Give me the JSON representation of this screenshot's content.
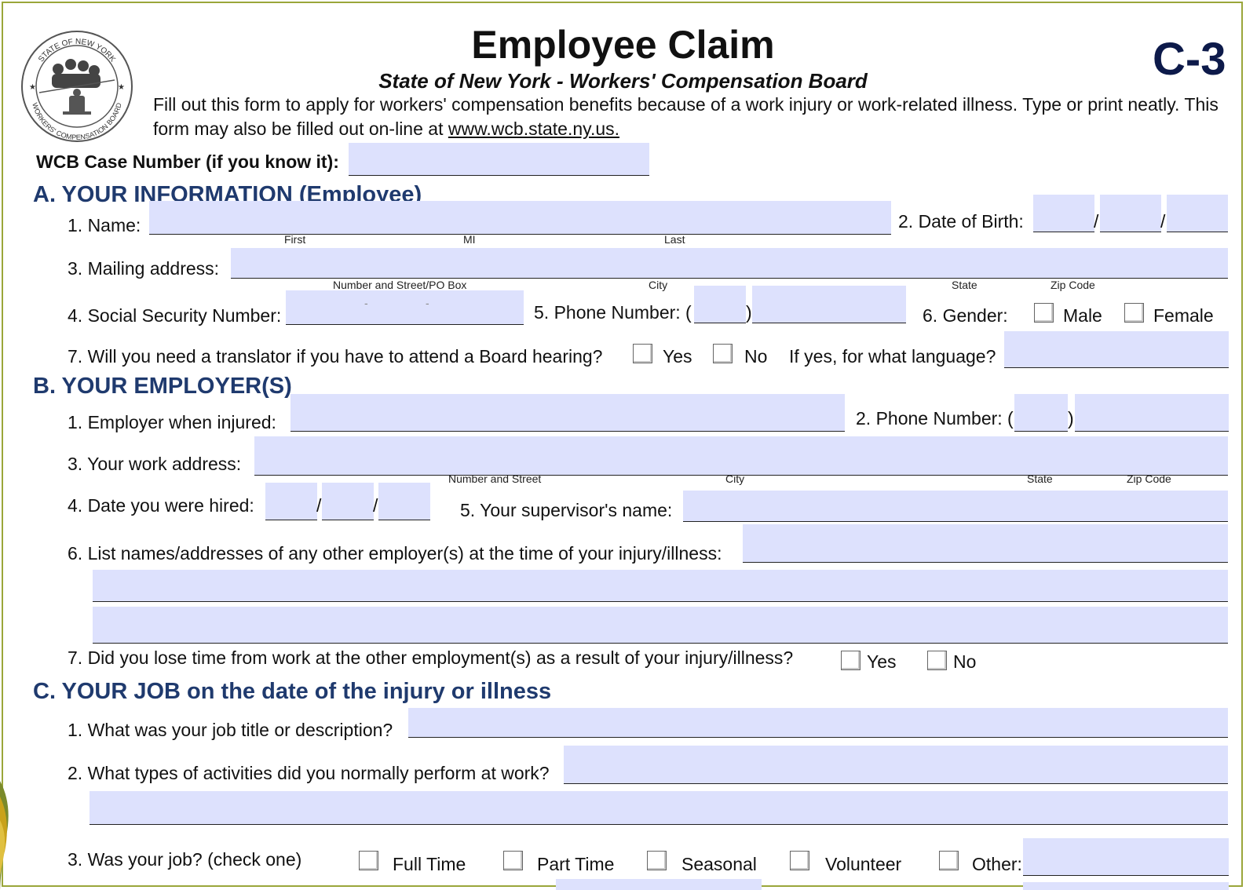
{
  "header": {
    "title": "Employee Claim",
    "subtitle": "State of New York - Workers' Compensation Board",
    "form_code": "C-3",
    "seal_text_top": "STATE OF NEW YORK",
    "seal_text_bottom": "WORKERS' COMPENSATION BOARD",
    "intro_text": "Fill out this form to apply for workers' compensation benefits because of a work injury or work-related illness.  Type or print neatly.  This form may also be filled out on-line at ",
    "intro_link": "www.wcb.state.ny.us."
  },
  "case_number": {
    "label": "WCB Case Number (if you know it):",
    "value": ""
  },
  "section_a": {
    "heading": "A. YOUR INFORMATION (Employee)",
    "name_label": "1. Name:",
    "name_sub": {
      "first": "First",
      "mi": "MI",
      "last": "Last"
    },
    "dob_label": "2. Date of Birth:",
    "address_label": "3. Mailing address:",
    "address_sub": {
      "street": "Number and Street/PO Box",
      "city": "City",
      "state": "State",
      "zip": "Zip Code"
    },
    "ssn_label": "4. Social Security Number:",
    "ssn_dashes": "-",
    "phone_label": "5. Phone Number: (",
    "phone_close": ")",
    "gender_label": "6. Gender:",
    "gender_male": "Male",
    "gender_female": "Female",
    "translator_label": "7. Will you need a translator if you have to attend a Board hearing?",
    "yes": "Yes",
    "no": "No",
    "language_label": "If yes, for what language?"
  },
  "section_b": {
    "heading": "B. YOUR EMPLOYER(S)",
    "employer_label": "1. Employer when injured:",
    "phone_label": "2. Phone Number: (",
    "phone_close": ")",
    "work_address_label": "3. Your work address:",
    "address_sub": {
      "street": "Number and Street",
      "city": "City",
      "state": "State",
      "zip": "Zip Code"
    },
    "hired_label": "4. Date you were hired:",
    "supervisor_label": "5. Your supervisor's name:",
    "other_employers_label": "6. List names/addresses of any other employer(s) at the time of your injury/illness:",
    "lose_time_label": "7. Did you lose time from work at the other employment(s) as a result of your injury/illness?",
    "yes": "Yes",
    "no": "No"
  },
  "section_c": {
    "heading": "C. YOUR JOB on the date of the injury or illness",
    "job_title_label": "1. What was your job title or description?",
    "activities_label": "2. What types of activities did you normally perform at work?",
    "job_type_label": "3. Was your job? (check one)",
    "options": [
      "Full Time",
      "Part Time",
      "Seasonal",
      "Volunteer",
      "Other:"
    ]
  },
  "date_separator": "/",
  "colors": {
    "field_fill": "#dde1fd",
    "section_heading": "#1f3a6e",
    "frame": "#9aa63a"
  }
}
